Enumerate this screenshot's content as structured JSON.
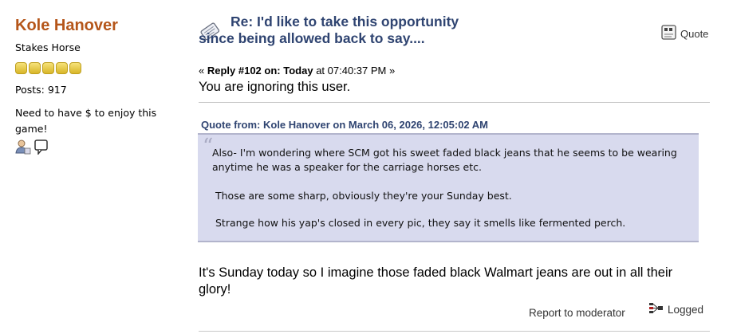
{
  "poster": {
    "name": "Kole Hanover",
    "group": "Stakes Horse",
    "stars": 5,
    "posts": "Posts: 917",
    "personal_text": "Need to have $ to enjoy this game!",
    "icons": [
      "profile-icon",
      "message-icon"
    ]
  },
  "post": {
    "subject": "Re: I'd like to take this opportunity since being allowed back to say....",
    "reply_prefix": "« ",
    "reply_label": "Reply #102 on:",
    "reply_day": "Today",
    "reply_time": "at 07:40:37 PM »",
    "quote_button": "Quote",
    "ignore_message": "You are ignoring this user.",
    "quote": {
      "header": "Quote from: Kole Hanover on March 06, 2026, 12:05:02 AM",
      "lines": [
        "Also- I'm wondering where SCM got his sweet faded black jeans that he seems to be wearing anytime he was a speaker for the carriage horses etc.",
        "Those are some sharp, obviously they're your Sunday best.",
        "Strange how his yap's closed in every pic, they say it smells like fermented perch."
      ]
    },
    "body": " It's Sunday today so I imagine those faded black Walmart jeans are out in all their glory!",
    "report_link": "Report to moderator",
    "logged": "Logged"
  }
}
